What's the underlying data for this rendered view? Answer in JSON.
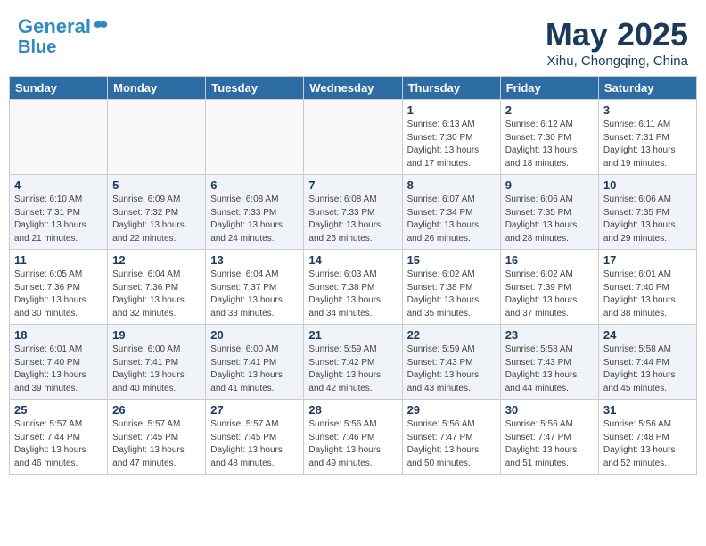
{
  "header": {
    "logo_line1": "General",
    "logo_line2": "Blue",
    "month": "May 2025",
    "location": "Xihu, Chongqing, China"
  },
  "days_of_week": [
    "Sunday",
    "Monday",
    "Tuesday",
    "Wednesday",
    "Thursday",
    "Friday",
    "Saturday"
  ],
  "weeks": [
    [
      {
        "day": "",
        "info": ""
      },
      {
        "day": "",
        "info": ""
      },
      {
        "day": "",
        "info": ""
      },
      {
        "day": "",
        "info": ""
      },
      {
        "day": "1",
        "info": "Sunrise: 6:13 AM\nSunset: 7:30 PM\nDaylight: 13 hours\nand 17 minutes."
      },
      {
        "day": "2",
        "info": "Sunrise: 6:12 AM\nSunset: 7:30 PM\nDaylight: 13 hours\nand 18 minutes."
      },
      {
        "day": "3",
        "info": "Sunrise: 6:11 AM\nSunset: 7:31 PM\nDaylight: 13 hours\nand 19 minutes."
      }
    ],
    [
      {
        "day": "4",
        "info": "Sunrise: 6:10 AM\nSunset: 7:31 PM\nDaylight: 13 hours\nand 21 minutes."
      },
      {
        "day": "5",
        "info": "Sunrise: 6:09 AM\nSunset: 7:32 PM\nDaylight: 13 hours\nand 22 minutes."
      },
      {
        "day": "6",
        "info": "Sunrise: 6:08 AM\nSunset: 7:33 PM\nDaylight: 13 hours\nand 24 minutes."
      },
      {
        "day": "7",
        "info": "Sunrise: 6:08 AM\nSunset: 7:33 PM\nDaylight: 13 hours\nand 25 minutes."
      },
      {
        "day": "8",
        "info": "Sunrise: 6:07 AM\nSunset: 7:34 PM\nDaylight: 13 hours\nand 26 minutes."
      },
      {
        "day": "9",
        "info": "Sunrise: 6:06 AM\nSunset: 7:35 PM\nDaylight: 13 hours\nand 28 minutes."
      },
      {
        "day": "10",
        "info": "Sunrise: 6:06 AM\nSunset: 7:35 PM\nDaylight: 13 hours\nand 29 minutes."
      }
    ],
    [
      {
        "day": "11",
        "info": "Sunrise: 6:05 AM\nSunset: 7:36 PM\nDaylight: 13 hours\nand 30 minutes."
      },
      {
        "day": "12",
        "info": "Sunrise: 6:04 AM\nSunset: 7:36 PM\nDaylight: 13 hours\nand 32 minutes."
      },
      {
        "day": "13",
        "info": "Sunrise: 6:04 AM\nSunset: 7:37 PM\nDaylight: 13 hours\nand 33 minutes."
      },
      {
        "day": "14",
        "info": "Sunrise: 6:03 AM\nSunset: 7:38 PM\nDaylight: 13 hours\nand 34 minutes."
      },
      {
        "day": "15",
        "info": "Sunrise: 6:02 AM\nSunset: 7:38 PM\nDaylight: 13 hours\nand 35 minutes."
      },
      {
        "day": "16",
        "info": "Sunrise: 6:02 AM\nSunset: 7:39 PM\nDaylight: 13 hours\nand 37 minutes."
      },
      {
        "day": "17",
        "info": "Sunrise: 6:01 AM\nSunset: 7:40 PM\nDaylight: 13 hours\nand 38 minutes."
      }
    ],
    [
      {
        "day": "18",
        "info": "Sunrise: 6:01 AM\nSunset: 7:40 PM\nDaylight: 13 hours\nand 39 minutes."
      },
      {
        "day": "19",
        "info": "Sunrise: 6:00 AM\nSunset: 7:41 PM\nDaylight: 13 hours\nand 40 minutes."
      },
      {
        "day": "20",
        "info": "Sunrise: 6:00 AM\nSunset: 7:41 PM\nDaylight: 13 hours\nand 41 minutes."
      },
      {
        "day": "21",
        "info": "Sunrise: 5:59 AM\nSunset: 7:42 PM\nDaylight: 13 hours\nand 42 minutes."
      },
      {
        "day": "22",
        "info": "Sunrise: 5:59 AM\nSunset: 7:43 PM\nDaylight: 13 hours\nand 43 minutes."
      },
      {
        "day": "23",
        "info": "Sunrise: 5:58 AM\nSunset: 7:43 PM\nDaylight: 13 hours\nand 44 minutes."
      },
      {
        "day": "24",
        "info": "Sunrise: 5:58 AM\nSunset: 7:44 PM\nDaylight: 13 hours\nand 45 minutes."
      }
    ],
    [
      {
        "day": "25",
        "info": "Sunrise: 5:57 AM\nSunset: 7:44 PM\nDaylight: 13 hours\nand 46 minutes."
      },
      {
        "day": "26",
        "info": "Sunrise: 5:57 AM\nSunset: 7:45 PM\nDaylight: 13 hours\nand 47 minutes."
      },
      {
        "day": "27",
        "info": "Sunrise: 5:57 AM\nSunset: 7:45 PM\nDaylight: 13 hours\nand 48 minutes."
      },
      {
        "day": "28",
        "info": "Sunrise: 5:56 AM\nSunset: 7:46 PM\nDaylight: 13 hours\nand 49 minutes."
      },
      {
        "day": "29",
        "info": "Sunrise: 5:56 AM\nSunset: 7:47 PM\nDaylight: 13 hours\nand 50 minutes."
      },
      {
        "day": "30",
        "info": "Sunrise: 5:56 AM\nSunset: 7:47 PM\nDaylight: 13 hours\nand 51 minutes."
      },
      {
        "day": "31",
        "info": "Sunrise: 5:56 AM\nSunset: 7:48 PM\nDaylight: 13 hours\nand 52 minutes."
      }
    ]
  ]
}
